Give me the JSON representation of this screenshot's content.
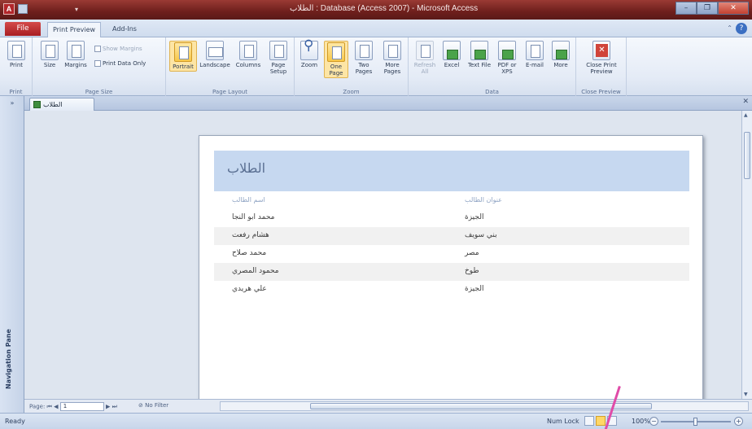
{
  "window": {
    "title": "الطلاب : Database (Access 2007) - Microsoft Access",
    "controls": [
      "–",
      "❐",
      "✕"
    ]
  },
  "tabs": {
    "file": "File",
    "print_preview": "Print Preview",
    "add_ins": "Add-Ins"
  },
  "ribbon": {
    "print_group": {
      "label": "Print",
      "print": "Print"
    },
    "page_size_group": {
      "label": "Page Size",
      "size": "Size",
      "margins": "Margins",
      "show_margins": "Show Margins",
      "print_data_only": "Print Data Only"
    },
    "page_layout_group": {
      "label": "Page Layout",
      "portrait": "Portrait",
      "landscape": "Landscape",
      "columns": "Columns",
      "page_setup": "Page Setup"
    },
    "zoom_group": {
      "label": "Zoom",
      "zoom": "Zoom",
      "one_page": "One Page",
      "two_pages": "Two Pages",
      "more_pages": "More Pages"
    },
    "data_group": {
      "label": "Data",
      "refresh_all": "Refresh All",
      "excel": "Excel",
      "text_file": "Text File",
      "pdf_xps": "PDF or XPS",
      "email": "E-mail",
      "more": "More"
    },
    "close_group": {
      "label": "Close Preview",
      "close_print_preview": "Close Print Preview"
    }
  },
  "navigation_pane": {
    "label": "Navigation Pane",
    "toggle": "»"
  },
  "document": {
    "tab_label": "الطلاب",
    "report": {
      "title": "الطلاب",
      "columns": [
        "اسم الطالب",
        "عنوان الطالب"
      ],
      "rows": [
        [
          "محمد ابو النجا",
          "الجيزة"
        ],
        [
          "هشام رفعت",
          "بني سويف"
        ],
        [
          "محمد صلاح",
          "مصر"
        ],
        [
          "محمود المصري",
          "طوخ"
        ],
        [
          "علي هريدي",
          "الجيزة"
        ]
      ]
    }
  },
  "record_nav": {
    "page_label": "Page:",
    "page_value": "1",
    "no_filter": "No Filter"
  },
  "statusbar": {
    "ready": "Ready",
    "num_lock": "Num Lock",
    "zoom_level": "100%",
    "zoom_minus": "−",
    "zoom_plus": "+"
  },
  "colors": {
    "title_bar": "#7a2a2a",
    "file_tab": "#b2262a",
    "report_header": "#c6d8f0",
    "alt_row": "#f1f1f1",
    "annotation_pen": "#e04ba8"
  }
}
